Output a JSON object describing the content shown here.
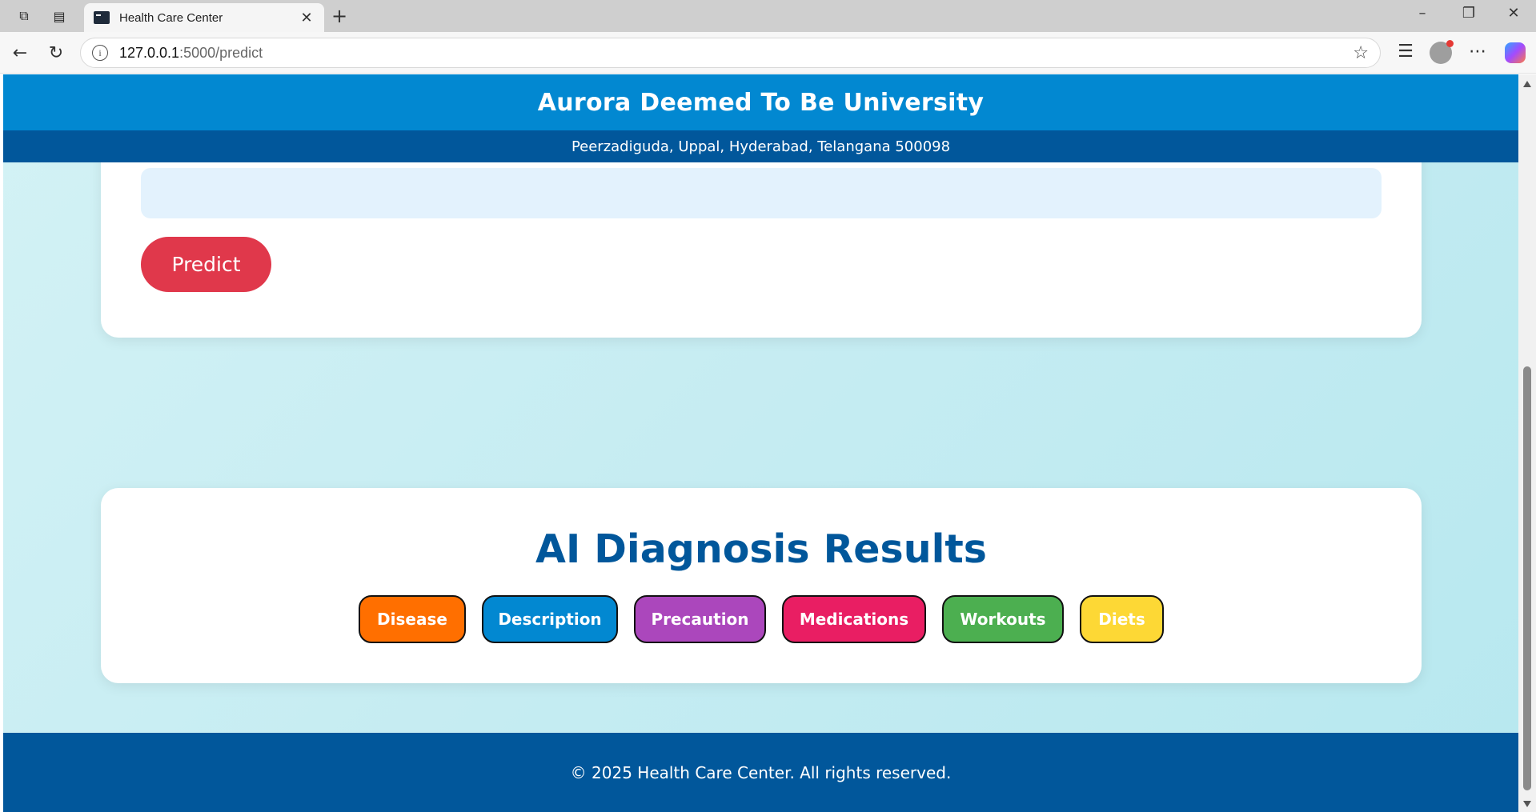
{
  "browser": {
    "tab_title": "Health Care Center",
    "url_host": "127.0.0.1",
    "url_path": ":5000/predict"
  },
  "header": {
    "title": "Aurora Deemed To Be University",
    "address": "Peerzadiguda, Uppal, Hyderabad, Telangana 500098"
  },
  "symptom_form": {
    "input_value": "",
    "predict_label": "Predict"
  },
  "results": {
    "heading": "AI Diagnosis Results",
    "buttons": [
      {
        "label": "Disease",
        "color": "#ff6f00"
      },
      {
        "label": "Description",
        "color": "#0288d1"
      },
      {
        "label": "Precaution",
        "color": "#ab47bc"
      },
      {
        "label": "Medications",
        "color": "#e91e63"
      },
      {
        "label": "Workouts",
        "color": "#4caf50"
      },
      {
        "label": "Diets",
        "color": "#fdd835"
      }
    ]
  },
  "footer": {
    "text": "© 2025 Health Care Center. All rights reserved."
  },
  "colors": {
    "header_primary": "#0288d1",
    "header_secondary": "#01579b",
    "predict_button": "#e0384b"
  }
}
